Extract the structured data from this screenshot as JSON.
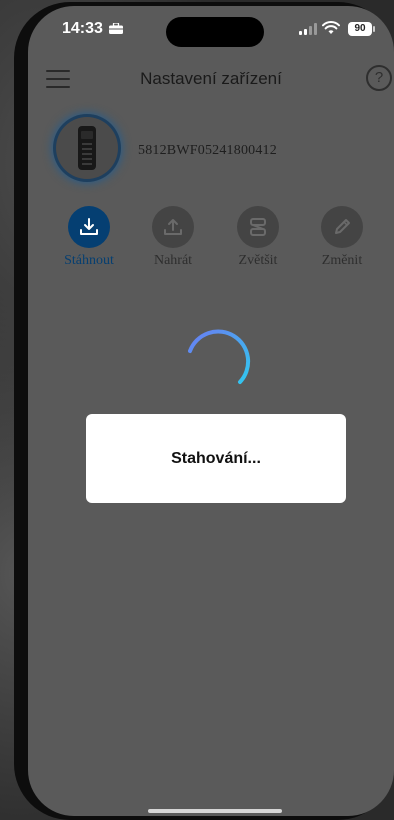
{
  "status_bar": {
    "time": "14:33",
    "battery": "90"
  },
  "header": {
    "title": "Nastavení zařízení",
    "help": "?"
  },
  "device": {
    "id": "5812BWF05241800412"
  },
  "actions": [
    {
      "label": "Stáhnout",
      "icon": "download-icon",
      "active": true
    },
    {
      "label": "Nahrát",
      "icon": "upload-icon",
      "active": false
    },
    {
      "label": "Zvětšit",
      "icon": "enlarge-icon",
      "active": false
    },
    {
      "label": "Změnit",
      "icon": "edit-icon",
      "active": false
    }
  ],
  "dialog": {
    "text": "Stahování..."
  },
  "colors": {
    "accent": "#053f72",
    "spinner_start": "#6a7df2",
    "spinner_end": "#31c7ef"
  }
}
